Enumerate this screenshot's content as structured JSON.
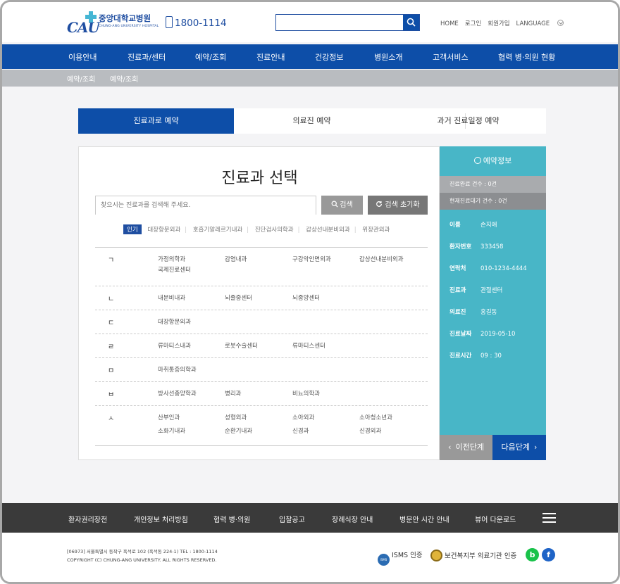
{
  "header": {
    "logo_en": "CAU",
    "logo_ko": "중앙대학교병원",
    "logo_sub": "CHUNG-ANG UNIVERSITY HOSPITAL",
    "phone": "1800-1114",
    "search_placeholder": "",
    "utils": [
      "HOME",
      "로그인",
      "회원가입",
      "LANGUAGE"
    ]
  },
  "mainnav": [
    "이용안내",
    "진료과/센터",
    "예약/조회",
    "진료안내",
    "건강정보",
    "병원소개",
    "고객서비스",
    "협력 병·의원 현황"
  ],
  "breadcrumb": [
    "예약/조회",
    "예약/조회"
  ],
  "tabs": [
    "진료과로 예약",
    "의료진 예약",
    "과거 진료일정 예약"
  ],
  "panel": {
    "title": "진료과 선택",
    "search_placeholder": "찾으시는 진료과를 검색해 주세요.",
    "search_label": "검색",
    "reset_label": "검색 초기화",
    "popular_tag": "인기",
    "popular": [
      "대장항문외과",
      "호흡기알레르기내과",
      "진단검사의학과",
      "갑상선내분비외과",
      "위장관외과"
    ],
    "groups": [
      {
        "consonant": "ㄱ",
        "depts": [
          "가정의학과",
          "감염내과",
          "구강악안면외과",
          "갑상선내분비외과",
          "국제진료센터"
        ]
      },
      {
        "consonant": "ㄴ",
        "depts": [
          "내분비내과",
          "뇌졸중센터",
          "뇌종양센터"
        ]
      },
      {
        "consonant": "ㄷ",
        "depts": [
          "대장항문외과"
        ]
      },
      {
        "consonant": "ㄹ",
        "depts": [
          "류마티스내과",
          "로봇수술센터",
          "류마티스센터"
        ]
      },
      {
        "consonant": "ㅁ",
        "depts": [
          "마취통증의학과"
        ]
      },
      {
        "consonant": "ㅂ",
        "depts": [
          "방사선종양학과",
          "병리과",
          "비뇨의학과"
        ]
      },
      {
        "consonant": "ㅅ",
        "depts": [
          "산부인과",
          "성형외과",
          "소아외과",
          "소아청소년과",
          "소화기내과",
          "순환기내과",
          "신경과",
          "신경외과"
        ]
      }
    ]
  },
  "info": {
    "title": "예약정보",
    "done": "진료완료 건수 : 0건",
    "wait": "현재진료대기 건수 : 0건",
    "rows": [
      {
        "label": "이름",
        "value": "손지애"
      },
      {
        "label": "환자번호",
        "value": "333458"
      },
      {
        "label": "연락처",
        "value": "010-1234-4444"
      },
      {
        "label": "진료과",
        "value": "관절센터"
      },
      {
        "label": "의료진",
        "value": "홍길동"
      },
      {
        "label": "진료날짜",
        "value": "2019-05-10"
      },
      {
        "label": "진료시간",
        "value": "09 : 30"
      }
    ],
    "prev": "이전단계",
    "next": "다음단계"
  },
  "footnav": [
    "환자권리장전",
    "개인정보 처리방침",
    "협력 병·의원",
    "입찰공고",
    "장례식장 안내",
    "병문안 시간 안내",
    "뷰어 다운로드"
  ],
  "footer": {
    "address": "[06973] 서울특별시 동작구 흑석로 102 (흑석동 224-1) TEL : 1800-1114",
    "copyright": "COPYRIGHT (C) CHUNG-ANG UNIVERSITY. ALL RIGHTS RESERVED.",
    "isms_badge": "ISMS",
    "cert1": "ISMS 인증",
    "cert2": "보건복지부 의료기관 인증",
    "blog": "b",
    "facebook": "f"
  },
  "colors": {
    "primary": "#0d4ea8",
    "info_panel": "#48b6c7",
    "footer_dark": "#3a3a3a"
  }
}
